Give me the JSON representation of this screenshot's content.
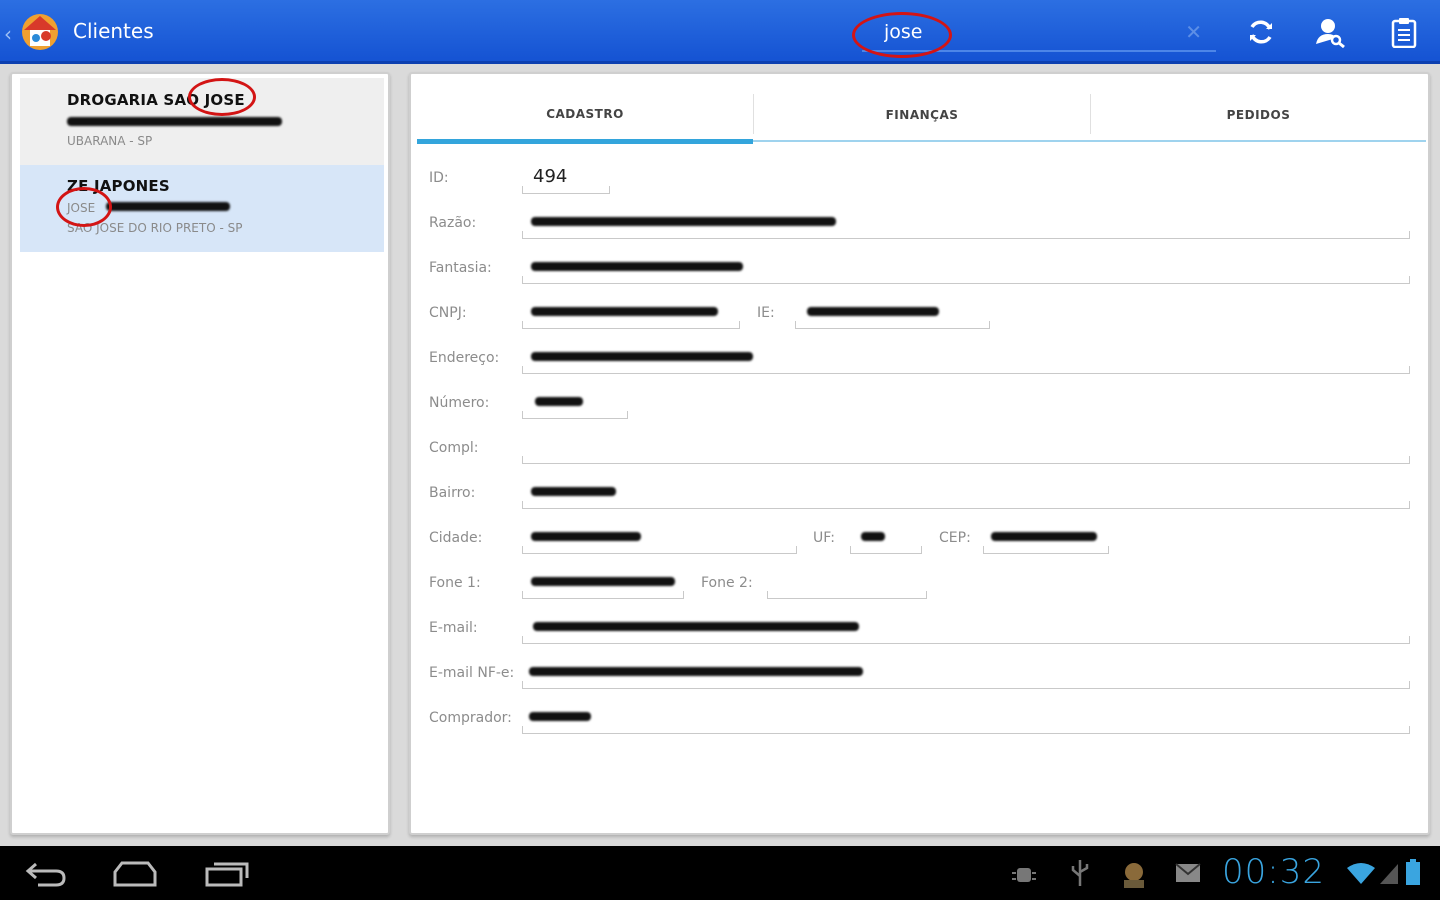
{
  "app": {
    "title": "Clientes"
  },
  "search": {
    "value": "jose"
  },
  "clients": [
    {
      "name": "DROGARIA SAO JOSE",
      "location": "UBARANA - SP"
    },
    {
      "name": "ZE JAPONES",
      "subtitle": "JOSE",
      "location": "SAO JOSE DO RIO PRETO - SP"
    }
  ],
  "tabs": [
    "CADASTRO",
    "FINANÇAS",
    "PEDIDOS"
  ],
  "form": {
    "labels": {
      "id": "ID:",
      "razao": "Razão:",
      "fantasia": "Fantasia:",
      "cnpj": "CNPJ:",
      "ie": "IE:",
      "endereco": "Endereço:",
      "numero": "Número:",
      "compl": "Compl:",
      "bairro": "Bairro:",
      "cidade": "Cidade:",
      "uf": "UF:",
      "cep": "CEP:",
      "fone1": "Fone 1:",
      "fone2": "Fone 2:",
      "email": "E-mail:",
      "email_nfe": "E-mail NF-e:",
      "comprador": "Comprador:"
    },
    "values": {
      "id": "494"
    }
  },
  "system": {
    "clock": "00:32"
  },
  "colors": {
    "actionbar": "#1a5ad8",
    "tab_indicator": "#33a5dc",
    "selected_item": "#d7e6f8",
    "annotation": "#d31414",
    "clock": "#3aa5e0"
  }
}
